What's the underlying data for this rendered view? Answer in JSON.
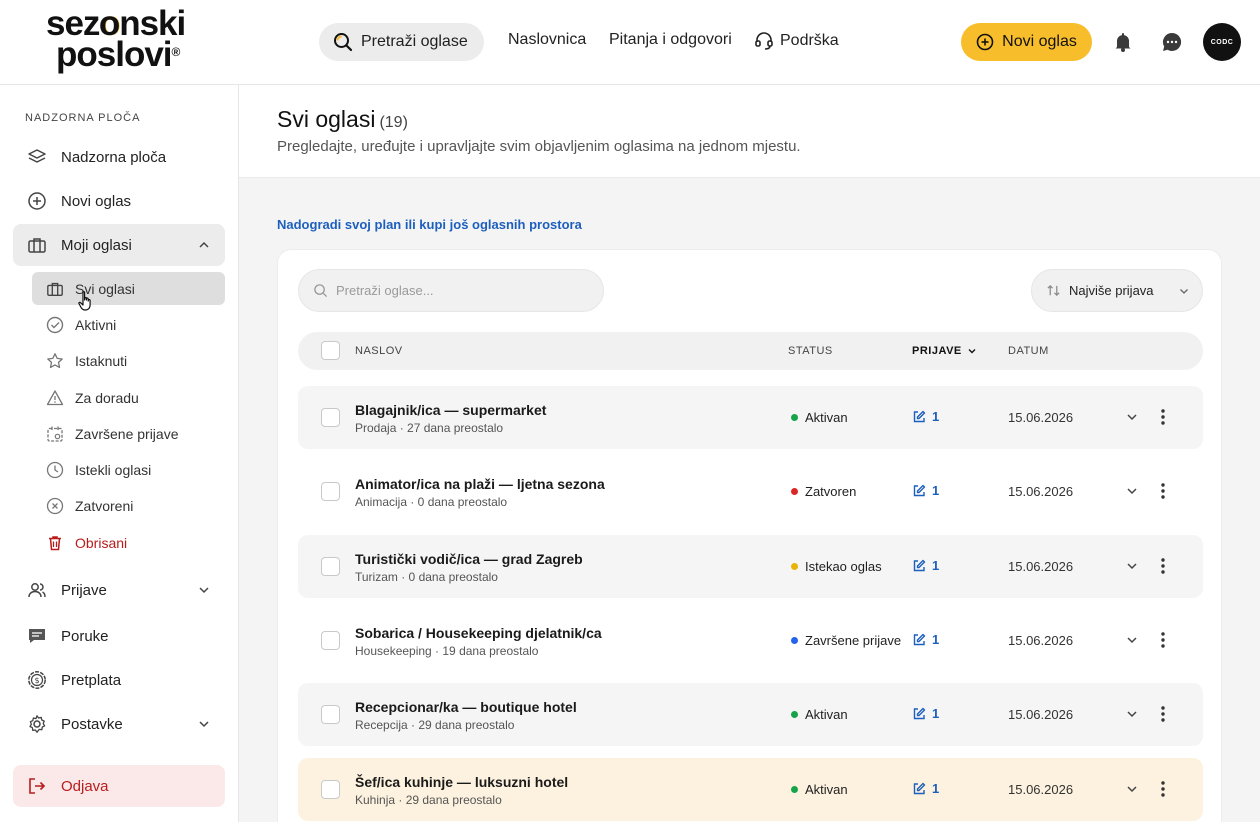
{
  "header": {
    "logo_line1_a": "sez",
    "logo_line1_b": "onski",
    "logo_line2": "poslovi",
    "logo_mark": "®",
    "search_label": "Pretraži oglase",
    "nav": [
      "Naslovnica",
      "Pitanja i odgovori",
      "Podrška"
    ],
    "cta_label": "Novi oglas",
    "icons": [
      "search-icon",
      "support-headset-icon",
      "plus-circle-icon",
      "bell-icon",
      "chat-icon"
    ],
    "avatar_text": "CODC"
  },
  "sidebar": {
    "section_label": "NADZORNA PLOČA",
    "items": [
      {
        "label": "Nadzorna ploča",
        "icon": "layers-icon"
      },
      {
        "label": "Novi oglas",
        "icon": "plus-circle-icon"
      },
      {
        "label": "Moji oglasi",
        "icon": "briefcase-icon",
        "expanded": true
      }
    ],
    "subitems": [
      {
        "label": "Svi oglasi",
        "icon": "briefcase-icon",
        "active": true
      },
      {
        "label": "Aktivni",
        "icon": "check-circle-icon"
      },
      {
        "label": "Istaknuti",
        "icon": "star-icon"
      },
      {
        "label": "Za doradu",
        "icon": "warning-icon"
      },
      {
        "label": "Završene prijave",
        "icon": "calendar-icon"
      },
      {
        "label": "Istekli oglasi",
        "icon": "clock-icon"
      },
      {
        "label": "Zatvoreni",
        "icon": "x-circle-icon"
      },
      {
        "label": "Obrisani",
        "icon": "trash-icon",
        "danger": true
      }
    ],
    "lower_items": [
      {
        "label": "Prijave",
        "icon": "users-icon",
        "has_chevron": true
      },
      {
        "label": "Poruke",
        "icon": "message-icon"
      },
      {
        "label": "Pretplata",
        "icon": "dollar-badge-icon"
      },
      {
        "label": "Postavke",
        "icon": "gear-icon",
        "has_chevron": true
      }
    ],
    "logout_label": "Odjava"
  },
  "page": {
    "title": "Svi oglasi",
    "count": "(19)",
    "subtitle": "Pregledajte, uređujte i upravljajte svim objavljenim oglasima na jednom mjestu.",
    "upgrade_link": "Nadogradi svoj plan ili kupi još oglasnih prostora"
  },
  "table": {
    "search_placeholder": "Pretraži oglase...",
    "sort_label": "Najviše prijava",
    "columns": {
      "title": "NASLOV",
      "status": "STATUS",
      "applications": "PRIJAVE",
      "date": "DATUM"
    },
    "rows": [
      {
        "title": "Blagajnik/ica — supermarket",
        "meta": "Prodaja · 27 dana preostalo",
        "status": "Aktivan",
        "status_color": "#16a34a",
        "applications": "1",
        "date": "15.06.2026"
      },
      {
        "title": "Animator/ica na plaži — ljetna sezona",
        "meta": "Animacija · 0 dana preostalo",
        "status": "Zatvoren",
        "status_color": "#dc2626",
        "applications": "1",
        "date": "15.06.2026"
      },
      {
        "title": "Turistički vodič/ica — grad Zagreb",
        "meta": "Turizam · 0 dana preostalo",
        "status": "Istekao oglas",
        "status_color": "#eab308",
        "applications": "1",
        "date": "15.06.2026"
      },
      {
        "title": "Sobarica / Housekeeping djelatnik/ca",
        "meta": "Housekeeping · 19 dana preostalo",
        "status": "Završene prijave",
        "status_color": "#2563eb",
        "applications": "1",
        "date": "15.06.2026"
      },
      {
        "title": "Recepcionar/ka — boutique hotel",
        "meta": "Recepcija · 29 dana preostalo",
        "status": "Aktivan",
        "status_color": "#16a34a",
        "applications": "1",
        "date": "15.06.2026"
      },
      {
        "title": "Šef/ica kuhinje — luksuzni hotel",
        "meta": "Kuhinja · 29 dana preostalo",
        "status": "Aktivan",
        "status_color": "#16a34a",
        "applications": "1",
        "date": "15.06.2026"
      }
    ]
  },
  "colors": {
    "accent": "#f7bd2b",
    "link": "#1d5fbd",
    "danger": "#b91c1c"
  }
}
